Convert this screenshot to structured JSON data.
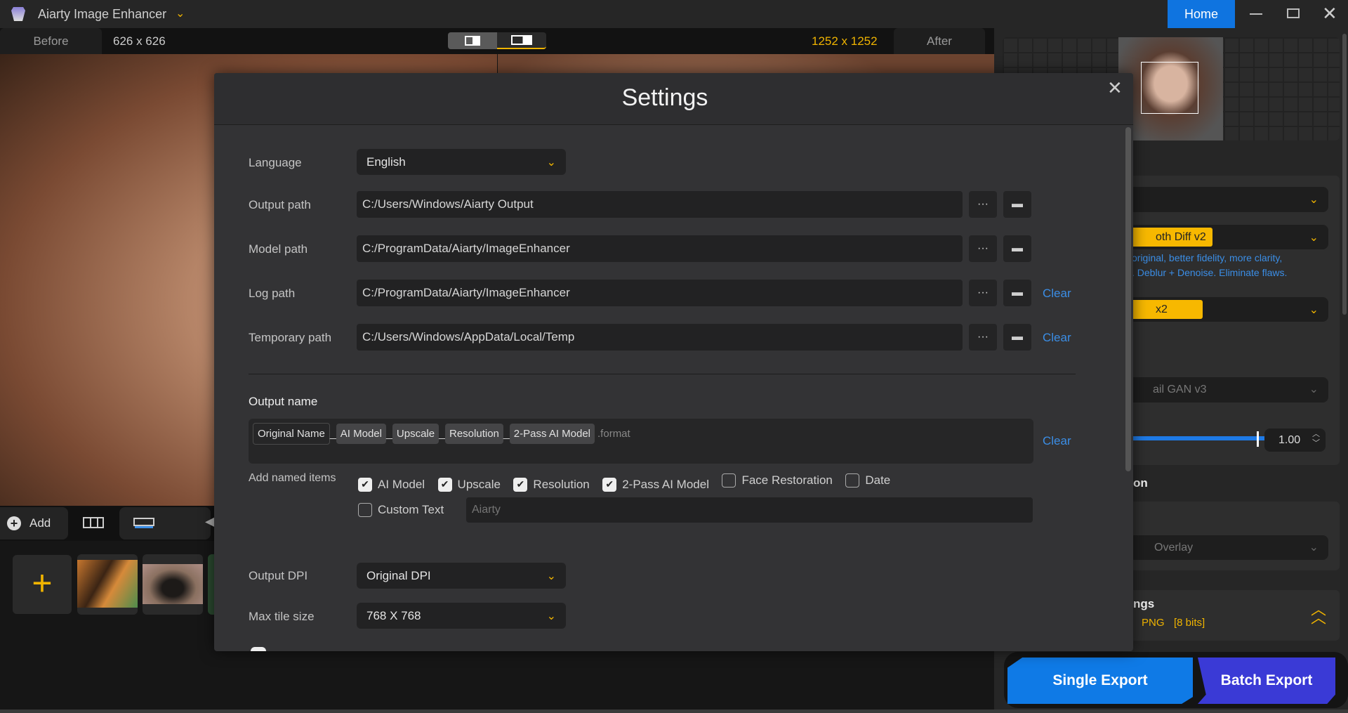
{
  "app": {
    "title": "Aiarty Image Enhancer",
    "home": "Home"
  },
  "compare": {
    "before": "Before",
    "before_res": "626 x 626",
    "after_res": "1252 x 1252",
    "after": "After"
  },
  "filmstrip": {
    "add": "Add"
  },
  "right_panel": {
    "model_tag": "oth Diff  v2",
    "model_desc_1": "original, better fidelity, more clarity,",
    "model_desc_2": ". Deblur + Denoise. Eliminate flaws.",
    "upscale_tag": "x2",
    "second_model": "ail GAN  v3",
    "strength": "1.00",
    "section_heading": "on",
    "overlay": "Overlay",
    "settings_heading": "ngs",
    "format": "PNG",
    "bits": "[8 bits]",
    "single_export": "Single Export",
    "batch_export": "Batch Export"
  },
  "settings": {
    "title": "Settings",
    "language_label": "Language",
    "language": "English",
    "output_path_label": "Output path",
    "output_path": "C:/Users/Windows/Aiarty Output",
    "model_path_label": "Model path",
    "model_path": "C:/ProgramData/Aiarty/ImageEnhancer",
    "log_path_label": "Log path",
    "log_path": "C:/ProgramData/Aiarty/ImageEnhancer",
    "temp_path_label": "Temporary path",
    "temp_path": "C:/Users/Windows/AppData/Local/Temp",
    "more": "···",
    "clear": "Clear",
    "output_name_label": "Output name",
    "chips": [
      "Original Name",
      "AI Model",
      "Upscale",
      "Resolution",
      "2-Pass AI Model"
    ],
    "sep": "_",
    "format_suffix": ".format",
    "add_named_items_label": "Add named items",
    "items": [
      {
        "label": "AI Model",
        "checked": true
      },
      {
        "label": "Upscale",
        "checked": true
      },
      {
        "label": "Resolution",
        "checked": true
      },
      {
        "label": "2-Pass AI Model",
        "checked": true
      },
      {
        "label": "Face Restoration",
        "checked": false
      },
      {
        "label": "Date",
        "checked": false
      }
    ],
    "custom_text_label": "Custom Text",
    "custom_text_placeholder": "Aiarty",
    "dpi_label": "Output DPI",
    "dpi": "Original DPI",
    "tile_label": "Max tile size",
    "tile": "768 X 768"
  },
  "colors": {
    "accent_blue": "#0f74e0",
    "accent_yellow": "#f0b400",
    "batch": "#3a3ad6"
  }
}
